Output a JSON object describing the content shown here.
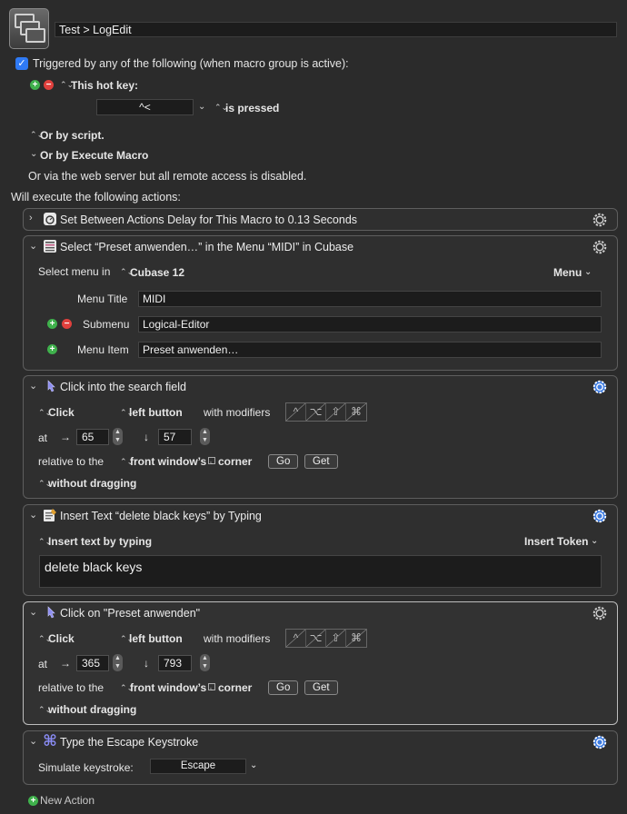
{
  "macro": {
    "name": "Test > LogEdit"
  },
  "trigger": {
    "triggered_label": "Triggered by any of the following (when macro group is active):",
    "hotkey_label": "This hot key:",
    "hotkey_value": "^<",
    "hotkey_state": "is pressed",
    "by_script": "Or by script.",
    "by_execute": "Or by Execute Macro",
    "web_server": "Or via the web server but all remote access is disabled."
  },
  "will_execute": "Will execute the following actions:",
  "actions": {
    "a1": {
      "title": "Set Between Actions Delay for This Macro to 0.13 Seconds"
    },
    "a2": {
      "title": "Select “Preset anwenden…” in the Menu “MIDI” in Cubase",
      "select_menu_in": "Select menu in",
      "app": "Cubase 12",
      "menu_dropdown": "Menu",
      "menu_title_label": "Menu Title",
      "menu_title_value": "MIDI",
      "submenu_label": "Submenu",
      "submenu_value": "Logical-Editor",
      "menu_item_label": "Menu Item",
      "menu_item_value": "Preset anwenden…"
    },
    "a3": {
      "title": "Click into the search field",
      "click": "Click",
      "button": "left button",
      "with_modifiers": "with modifiers",
      "at": "at",
      "x": "65",
      "y": "57",
      "relative_to": "relative to the",
      "front_window": "front window’s",
      "corner": "corner",
      "go": "Go",
      "get": "Get",
      "dragging": "without dragging"
    },
    "a4": {
      "title": "Insert Text “delete black keys” by Typing",
      "mode": "Insert text by typing",
      "insert_token": "Insert Token",
      "text": "delete black keys"
    },
    "a5": {
      "title": "Click on \"Preset anwenden\"",
      "click": "Click",
      "button": "left button",
      "with_modifiers": "with modifiers",
      "at": "at",
      "x": "365",
      "y": "793",
      "relative_to": "relative to the",
      "front_window": "front window’s",
      "corner": "corner",
      "go": "Go",
      "get": "Get",
      "dragging": "without dragging"
    },
    "a6": {
      "title": "Type the Escape Keystroke",
      "simulate": "Simulate keystroke:",
      "key": "Escape"
    }
  },
  "new_action": "New Action",
  "modifier_keys": [
    "^",
    "⌥",
    "⇧",
    "⌘"
  ],
  "colors": {
    "accent": "#2f7af5",
    "plus": "#3fb14c",
    "minus": "#e0403d",
    "gear_blue": "#3d7be0"
  }
}
